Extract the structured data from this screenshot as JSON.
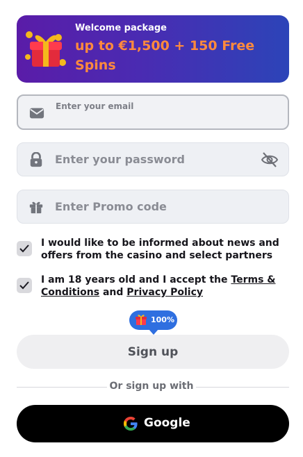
{
  "banner": {
    "subtitle": "Welcome package",
    "title": "up to €1,500 + 150 Free Spins",
    "icon": "gift-box-icon"
  },
  "form": {
    "email": {
      "placeholder": "Enter your email",
      "icon": "envelope-icon"
    },
    "password": {
      "placeholder": "Enter your password",
      "icon": "lock-icon",
      "toggle_icon": "eye-off-icon"
    },
    "promo": {
      "placeholder": "Enter Promo code",
      "icon": "gift-icon"
    }
  },
  "consents": {
    "news": {
      "text": "I would like to be informed about news and offers from the casino and select partners",
      "checked": true
    },
    "age": {
      "prefix": "I am 18 years old and I accept the ",
      "terms_link": "Terms & Conditions",
      "middle": " and ",
      "privacy_link": "Privacy Policy",
      "checked": true
    }
  },
  "badge": {
    "text": "100%",
    "icon": "gift-icon"
  },
  "signup": {
    "label": "Sign up"
  },
  "alt_signup": {
    "divider_text": "Or sign up with",
    "google_label": "Google"
  },
  "colors": {
    "accent_orange": "#ff8a3d",
    "banner_start": "#5a1ca8",
    "banner_end": "#2c44b8",
    "badge_blue": "#2f6fe0"
  }
}
